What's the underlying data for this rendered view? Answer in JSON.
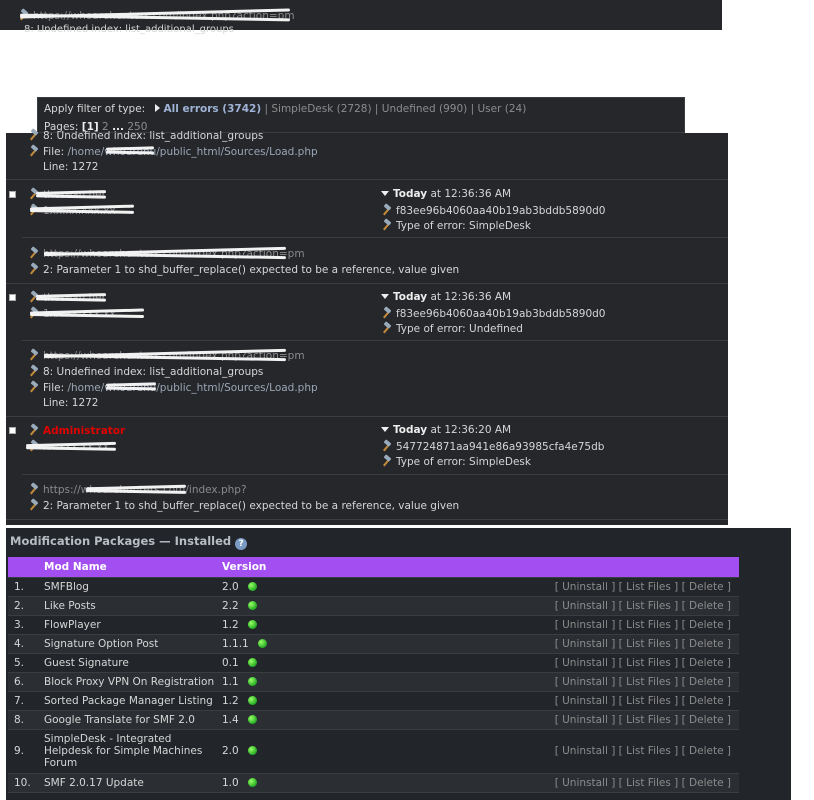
{
  "top_panel": {
    "url_text": "https://whoarehunters.com/index.php?action=pm",
    "error_text": "8: Undefined index: list_additional_groups"
  },
  "filter_bar": {
    "apply_label": "Apply filter of type:",
    "all_errors": "All errors (3742)",
    "sep": "|",
    "simpledesk": "SimpleDesk (2728)",
    "undefined": "Undefined (990)",
    "user": "User (24)",
    "pages_label": "Pages:",
    "page_current": "[1]",
    "page_2": "2",
    "ellipsis": "...",
    "page_last": "250"
  },
  "entries_top": {
    "error_text": "8: Undefined index: list_additional_groups",
    "file_label": "File:",
    "file_path": "/home/whoarehu/public_html/Sources/Load.php",
    "line_text": "Line: 1272"
  },
  "entries": [
    {
      "user": "thesearcher",
      "ip": "1xx.xx.xxx.xx",
      "date_bold": "Today",
      "date_rest": " at 12:36:36 AM",
      "hash": "f83ee96b4060aa40b19ab3bddb5890d0",
      "type_text": "Type of error: SimpleDesk",
      "url_text": "https://whoarehunters.com/index.php?action=pm",
      "error_text": "2: Parameter 1 to shd_buffer_replace() expected to be a reference, value given"
    },
    {
      "user": "thesearcher",
      "ip": "1xx.xx.xxx.xx",
      "date_bold": "Today",
      "date_rest": " at 12:36:36 AM",
      "hash": "f83ee96b4060aa40b19ab3bddb5890d0",
      "type_text": "Type of error: Undefined",
      "url_text": "https://whoarehunters.com/index.php?action=pm",
      "error_text": "8: Undefined index: list_additional_groups",
      "file_label": "File:",
      "file_path": "/home/whoarehu/public_html/Sources/Load.php",
      "line_text": "Line: 1272"
    },
    {
      "user": "Administrator",
      "ip": "xx.xxx.xx.xx",
      "date_bold": "Today",
      "date_rest": " at 12:36:20 AM",
      "hash": "547724871aa941e86a93985cfa4e75db",
      "type_text": "Type of error: SimpleDesk",
      "url_text": "https://whoarehunters.com/index.php?",
      "error_text": "2: Parameter 1 to shd_buffer_replace() expected to be a reference, value given"
    }
  ],
  "packages": {
    "title": "Modification Packages — Installed",
    "help_icon": "?",
    "col_name": "Mod Name",
    "col_version": "Version",
    "header_color": "#a24ef0",
    "action_uninstall": "[ Uninstall ]",
    "action_list": "[ List Files ]",
    "action_delete": "[ Delete ]",
    "rows": [
      {
        "num": "1.",
        "name": "SMFBlog",
        "version": "2.0"
      },
      {
        "num": "2.",
        "name": "Like Posts",
        "version": "2.2"
      },
      {
        "num": "3.",
        "name": "FlowPlayer",
        "version": "1.2"
      },
      {
        "num": "4.",
        "name": "Signature Option Post",
        "version": "1.1.1"
      },
      {
        "num": "5.",
        "name": "Guest Signature",
        "version": "0.1"
      },
      {
        "num": "6.",
        "name": "Block Proxy VPN On Registration",
        "version": "1.1"
      },
      {
        "num": "7.",
        "name": "Sorted Package Manager Listing",
        "version": "1.2"
      },
      {
        "num": "8.",
        "name": "Google Translate for SMF 2.0",
        "version": "1.4"
      },
      {
        "num": "9.",
        "name": "SimpleDesk - Integrated Helpdesk for Simple Machines Forum",
        "version": "2.0"
      },
      {
        "num": "10.",
        "name": "SMF 2.0.17 Update",
        "version": "1.0"
      }
    ]
  }
}
